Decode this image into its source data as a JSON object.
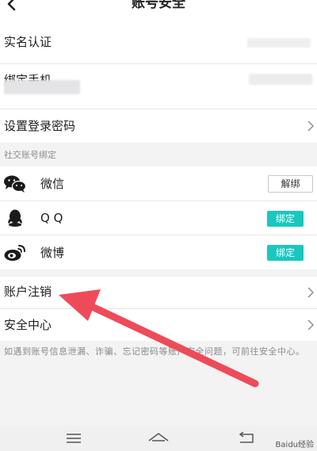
{
  "header": {
    "title": "账号安全",
    "back_icon": "chevron-left-icon"
  },
  "rows": {
    "real_name": {
      "label": "实名认证"
    },
    "phone": {
      "label": "绑定手机"
    },
    "password": {
      "label": "设置登录密码"
    }
  },
  "social": {
    "section_title": "社交账号绑定",
    "items": [
      {
        "name": "微信",
        "icon": "wechat-icon",
        "action": "解绑"
      },
      {
        "name": "Q Q",
        "icon": "qq-icon",
        "action": "绑定"
      },
      {
        "name": "微博",
        "icon": "weibo-icon",
        "action": "绑定"
      }
    ]
  },
  "account": {
    "cancel_label": "账户注销",
    "security_center_label": "安全中心",
    "tip": "如遇到账号信息泄漏、诈骗、忘记密码等账户安全问题，可前往安全中心。"
  },
  "colors": {
    "accent": "#19c7bf",
    "arrow": "#ee4b59"
  },
  "bottom_nav": {
    "icons": [
      "menu-icon",
      "home-icon",
      "back-icon"
    ]
  },
  "watermark": "Baidu经验"
}
